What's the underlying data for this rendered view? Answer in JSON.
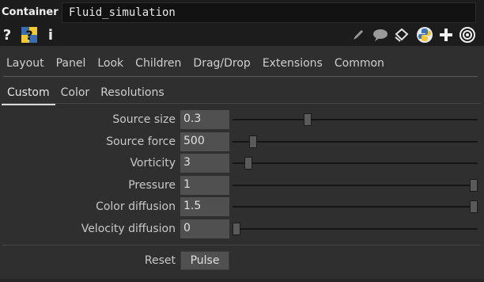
{
  "header": {
    "component_type": "Container",
    "component_name": "Fluid_simulation"
  },
  "icon_row": {
    "left": [
      "help-icon",
      "python-help-icon",
      "info-icon"
    ],
    "right": [
      "pencil-icon",
      "comment-icon",
      "clone-icon",
      "python-icon",
      "add-icon",
      "target-icon"
    ]
  },
  "pages": [
    "Layout",
    "Panel",
    "Look",
    "Children",
    "Drag/Drop",
    "Extensions",
    "Common"
  ],
  "subpages": [
    "Custom",
    "Color",
    "Resolutions"
  ],
  "active_subpage": "Custom",
  "params": [
    {
      "label": "Source size",
      "value": "0.3",
      "slider": 0.3
    },
    {
      "label": "Source force",
      "value": "500",
      "slider": 0.07
    },
    {
      "label": "Vorticity",
      "value": "3",
      "slider": 0.05
    },
    {
      "label": "Pressure",
      "value": "1",
      "slider": 1.0
    },
    {
      "label": "Color diffusion",
      "value": "1.5",
      "slider": 1.0
    },
    {
      "label": "Velocity diffusion",
      "value": "0",
      "slider": 0.0
    }
  ],
  "reset": {
    "label": "Reset",
    "button": "Pulse"
  },
  "colors": {
    "background": "#2f2f2f",
    "header": "#1c1c1c",
    "field": "#505050"
  }
}
